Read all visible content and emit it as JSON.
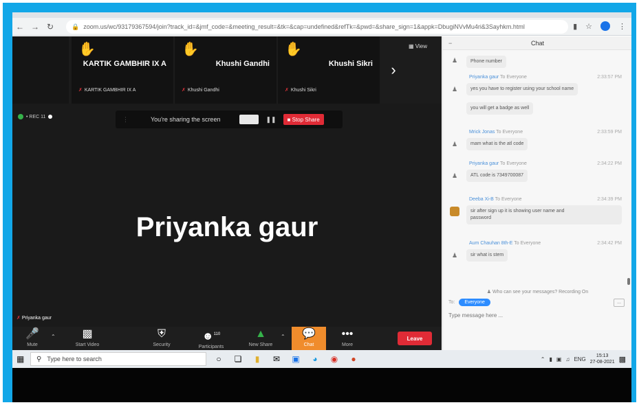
{
  "browser": {
    "url": "zoom.us/wc/93179367594/join?track_id=&jmf_code=&meeting_result=&tk=&cap=undefined&refTk=&pwd=&share_sign=1&appk=DbugiNVvMu4ri&3Sayhkm.html",
    "back_icon": "back-arrow-icon",
    "forward_icon": "forward-arrow-icon",
    "reload_icon": "reload-icon"
  },
  "meeting": {
    "participants": [
      {
        "name": "KARTIK GAMBHIR IX A",
        "sub": "KARTIK GAMBHIR IX A"
      },
      {
        "name": "Khushi Gandhi",
        "sub": "Khushi Gandhi"
      },
      {
        "name": "Khushi Sikri",
        "sub": "Khushi Sikri"
      }
    ],
    "view_label": "View",
    "status_text": "• REC 11",
    "share_banner": "You're sharing the screen",
    "stop_share": "Stop Share",
    "active_speaker": "Priyanka gaur",
    "speaker_tag": "Priyanka gaur"
  },
  "toolbar": {
    "mute": "Mute",
    "start_video": "Start Video",
    "security": "Security",
    "participants": "Participants",
    "participant_count": "110",
    "new_share": "New Share",
    "chat": "Chat",
    "more": "More",
    "leave": "Leave"
  },
  "chat": {
    "title": "Chat",
    "messages": [
      {
        "sender": "",
        "to": "",
        "time": "",
        "lines": [
          "Phone number"
        ]
      },
      {
        "sender": "Priyanka gaur",
        "to": "To Everyone",
        "time": "2:33:57 PM",
        "lines": [
          "yes you have to register using your school name"
        ]
      },
      {
        "sender": "",
        "to": "",
        "time": "",
        "lines": [
          "you will get a badge as well"
        ]
      },
      {
        "sender": "Mrick Jonas",
        "to": "To Everyone",
        "time": "2:33:59 PM",
        "lines": [
          "mam what is the atl code"
        ]
      },
      {
        "sender": "Priyanka gaur",
        "to": "To Everyone",
        "time": "2:34:22 PM",
        "lines": [
          "ATL code is 7349700087"
        ]
      },
      {
        "sender": "Deeba Xi-B",
        "to": "To Everyone",
        "time": "2:34:39 PM",
        "lines": [
          "sir after sign up it is showing user name and",
          "password"
        ]
      },
      {
        "sender": "Aum Chauhan 8th-E",
        "to": "To Everyone",
        "time": "2:34:42 PM",
        "lines": [
          "sir what is stem"
        ]
      }
    ],
    "recording_note": "Who can see your messages? Recording On",
    "to_label": "To:",
    "recipient": "Everyone",
    "more_label": "...",
    "input_placeholder": "Type message here ..."
  },
  "taskbar": {
    "search_placeholder": "Type here to search",
    "lang": "ENG",
    "time": "15:13",
    "date": "27-08-2021"
  }
}
